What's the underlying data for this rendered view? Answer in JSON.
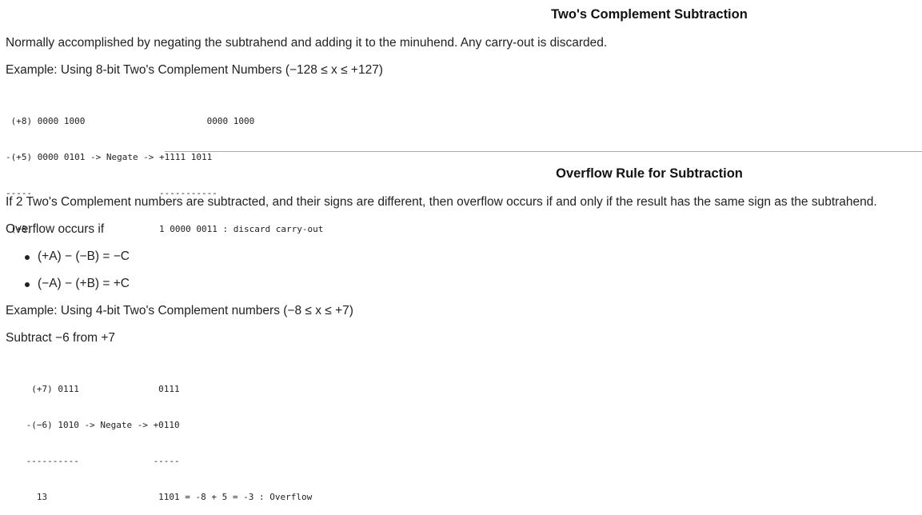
{
  "section1": {
    "heading": "Two's Complement Subtraction",
    "intro": "Normally accomplished by negating the subtrahend and adding it to the minuhend. Any carry-out is discarded.",
    "example_label": "Example: Using 8-bit Two's Complement Numbers (−128 ≤ x ≤ +127)",
    "code": [
      " (+8) 0000 1000                       0000 1000",
      "-(+5) 0000 0101 -> Negate -> +1111 1011",
      "-----                        -----------",
      " (+3)                        1 0000 0011 : discard carry-out"
    ]
  },
  "section2": {
    "heading": "Overflow Rule for Subtraction",
    "rule_text": "If 2 Two's Complement numbers are subtracted, and their signs are different, then overflow occurs if and only if the result has the same sign as the subtrahend.",
    "overflow_label": "Overflow occurs if",
    "bullets": [
      "(+A) − (−B) = −C",
      "(−A) − (+B) = +C"
    ],
    "example_label": "Example: Using 4-bit Two's Complement numbers (−8 ≤ x ≤ +7)",
    "subtract_label": "Subtract −6 from +7",
    "code": [
      "  (+7) 0111               0111",
      " -(−6) 1010 -> Negate -> +0110",
      " ----------              -----",
      "   13                     1101 = -8 + 5 = -3 : Overflow"
    ]
  }
}
